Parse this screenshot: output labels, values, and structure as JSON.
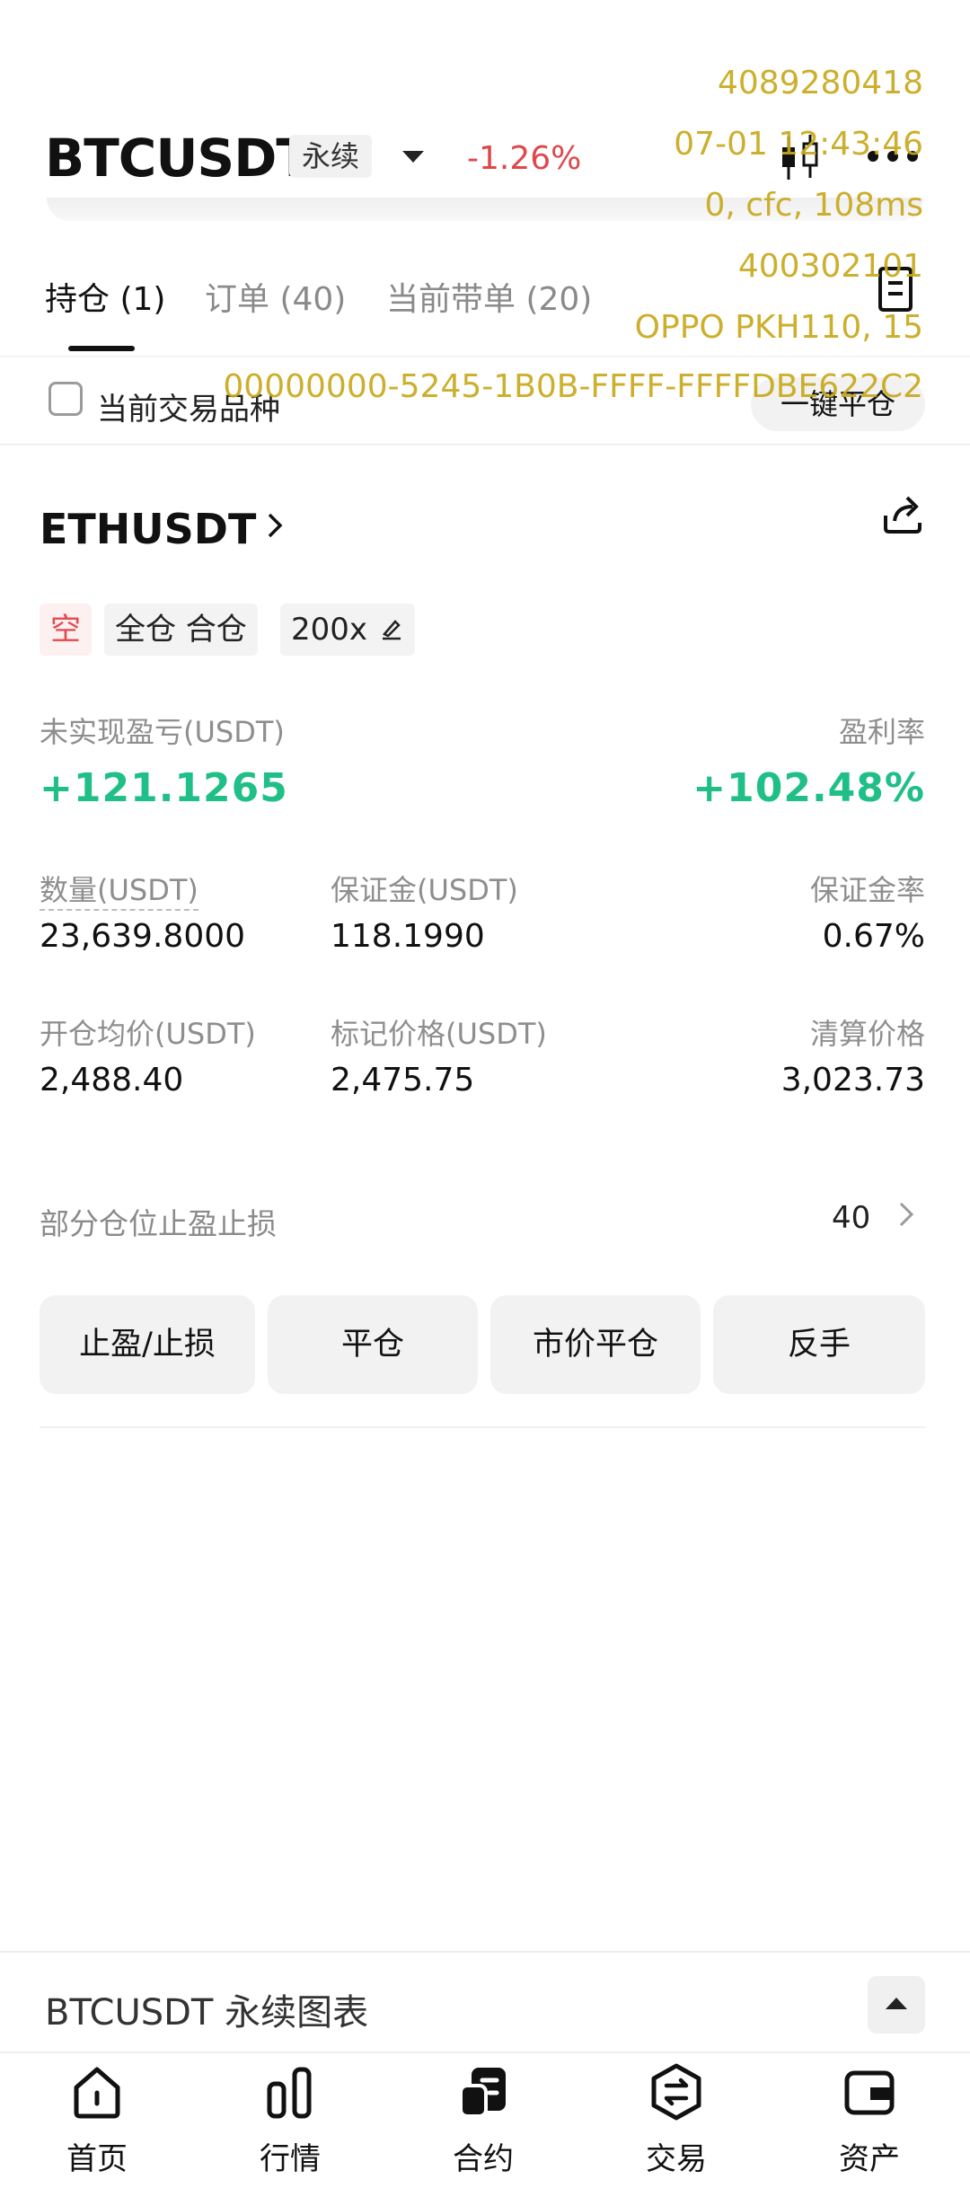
{
  "header": {
    "symbol": "BTCUSDT",
    "perp_tag": "永续",
    "change_pct": "-1.26%"
  },
  "tabs": [
    {
      "label": "持仓 (1)",
      "active": true
    },
    {
      "label": "订单 (40)",
      "active": false
    },
    {
      "label": "当前带单 (20)",
      "active": false
    }
  ],
  "filter": {
    "checkbox_label": "当前交易品种",
    "close_all_label": "一键平仓"
  },
  "position": {
    "symbol": "ETHUSDT",
    "tags": [
      "空",
      "全仓 合仓",
      "200x"
    ],
    "pnl_label": "未实现盈亏(USDT)",
    "pnl_value": "+121.1265",
    "roe_label": "盈利率",
    "roe_value": "+102.48%",
    "fields_row1": [
      {
        "label": "数量(USDT)",
        "value": "23,639.8000"
      },
      {
        "label": "保证金(USDT)",
        "value": "118.1990"
      },
      {
        "label": "保证金率",
        "value": "0.67%"
      }
    ],
    "fields_row2": [
      {
        "label": "开仓均价(USDT)",
        "value": "2,488.40"
      },
      {
        "label": "标记价格(USDT)",
        "value": "2,475.75"
      },
      {
        "label": "清算价格",
        "value": "3,023.73"
      }
    ],
    "partial_label": "部分仓位止盈止损",
    "partial_count": "40",
    "actions": [
      "止盈/止损",
      "平仓",
      "市价平仓",
      "反手"
    ]
  },
  "chart_drawer": {
    "title": "BTCUSDT 永续图表"
  },
  "bottom_nav": [
    {
      "label": "首页",
      "icon": "home-icon"
    },
    {
      "label": "行情",
      "icon": "market-icon"
    },
    {
      "label": "合约",
      "icon": "futures-icon"
    },
    {
      "label": "交易",
      "icon": "exchange-icon"
    },
    {
      "label": "资产",
      "icon": "wallet-icon"
    }
  ],
  "watermark": {
    "line1": "4089280418",
    "line2": "07-01 12:43:46",
    "line3": "0, cfc, 108ms",
    "line4": "400302101",
    "line5": "OPPO PKH110, 15",
    "line6": "00000000-5245-1B0B-FFFF-FFFFDBE622C2"
  },
  "colors": {
    "negative": "#e0474b",
    "positive": "#1fbf87",
    "watermark": "#c8a91c"
  }
}
